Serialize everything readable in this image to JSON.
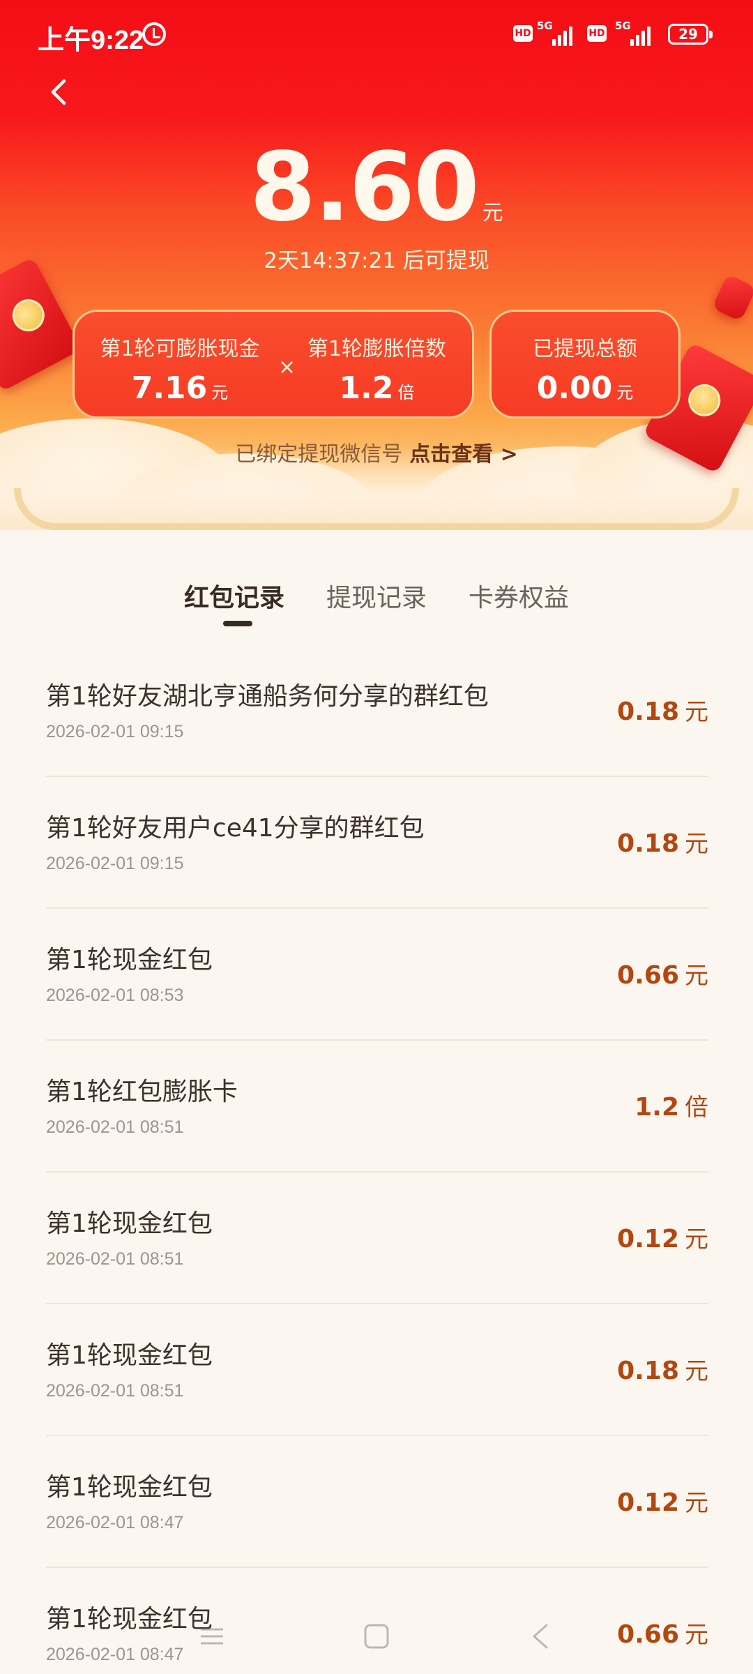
{
  "status_bar": {
    "time": "上午9:22",
    "network_1": "5G",
    "network_2": "5G",
    "hd_1": "HD",
    "hd_2": "HD",
    "battery": "29"
  },
  "header": {
    "balance": "8.60",
    "balance_unit": "元",
    "countdown": "2天14:37:21 后可提现",
    "card_left": {
      "cash_label": "第1轮可膨胀现金",
      "cash_value": "7.16",
      "cash_unit": "元",
      "times_sign": "×",
      "multiplier_label": "第1轮膨胀倍数",
      "multiplier_value": "1.2",
      "multiplier_unit": "倍"
    },
    "card_right": {
      "withdrawn_label": "已提现总额",
      "withdrawn_value": "0.00",
      "withdrawn_unit": "元"
    },
    "wechat_text": "已绑定提现微信号",
    "wechat_link": "点击查看 >"
  },
  "tabs": [
    {
      "label": "红包记录",
      "active": true
    },
    {
      "label": "提现记录",
      "active": false
    },
    {
      "label": "卡券权益",
      "active": false
    }
  ],
  "records": [
    {
      "title": "第1轮好友湖北亨通船务何分享的群红包",
      "date": "2026-02-01 09:15",
      "amount": "0.18",
      "unit": "元"
    },
    {
      "title": "第1轮好友用户ce41分享的群红包",
      "date": "2026-02-01 09:15",
      "amount": "0.18",
      "unit": "元"
    },
    {
      "title": "第1轮现金红包",
      "date": "2026-02-01 08:53",
      "amount": "0.66",
      "unit": "元"
    },
    {
      "title": "第1轮红包膨胀卡",
      "date": "2026-02-01 08:51",
      "amount": "1.2",
      "unit": "倍"
    },
    {
      "title": "第1轮现金红包",
      "date": "2026-02-01 08:51",
      "amount": "0.12",
      "unit": "元"
    },
    {
      "title": "第1轮现金红包",
      "date": "2026-02-01 08:51",
      "amount": "0.18",
      "unit": "元"
    },
    {
      "title": "第1轮现金红包",
      "date": "2026-02-01 08:47",
      "amount": "0.12",
      "unit": "元"
    },
    {
      "title": "第1轮现金红包",
      "date": "2026-02-01 08:47",
      "amount": "0.66",
      "unit": "元"
    }
  ],
  "icons": {
    "back": "chevron-left-icon",
    "alarm": "alarm-icon",
    "nav_menu": "menu-icon",
    "nav_home": "home-icon",
    "nav_back": "back-icon"
  },
  "colors": {
    "header_top": "#f40d15",
    "amount_accent": "#b4460f",
    "page_bg": "#fbf7f0"
  }
}
